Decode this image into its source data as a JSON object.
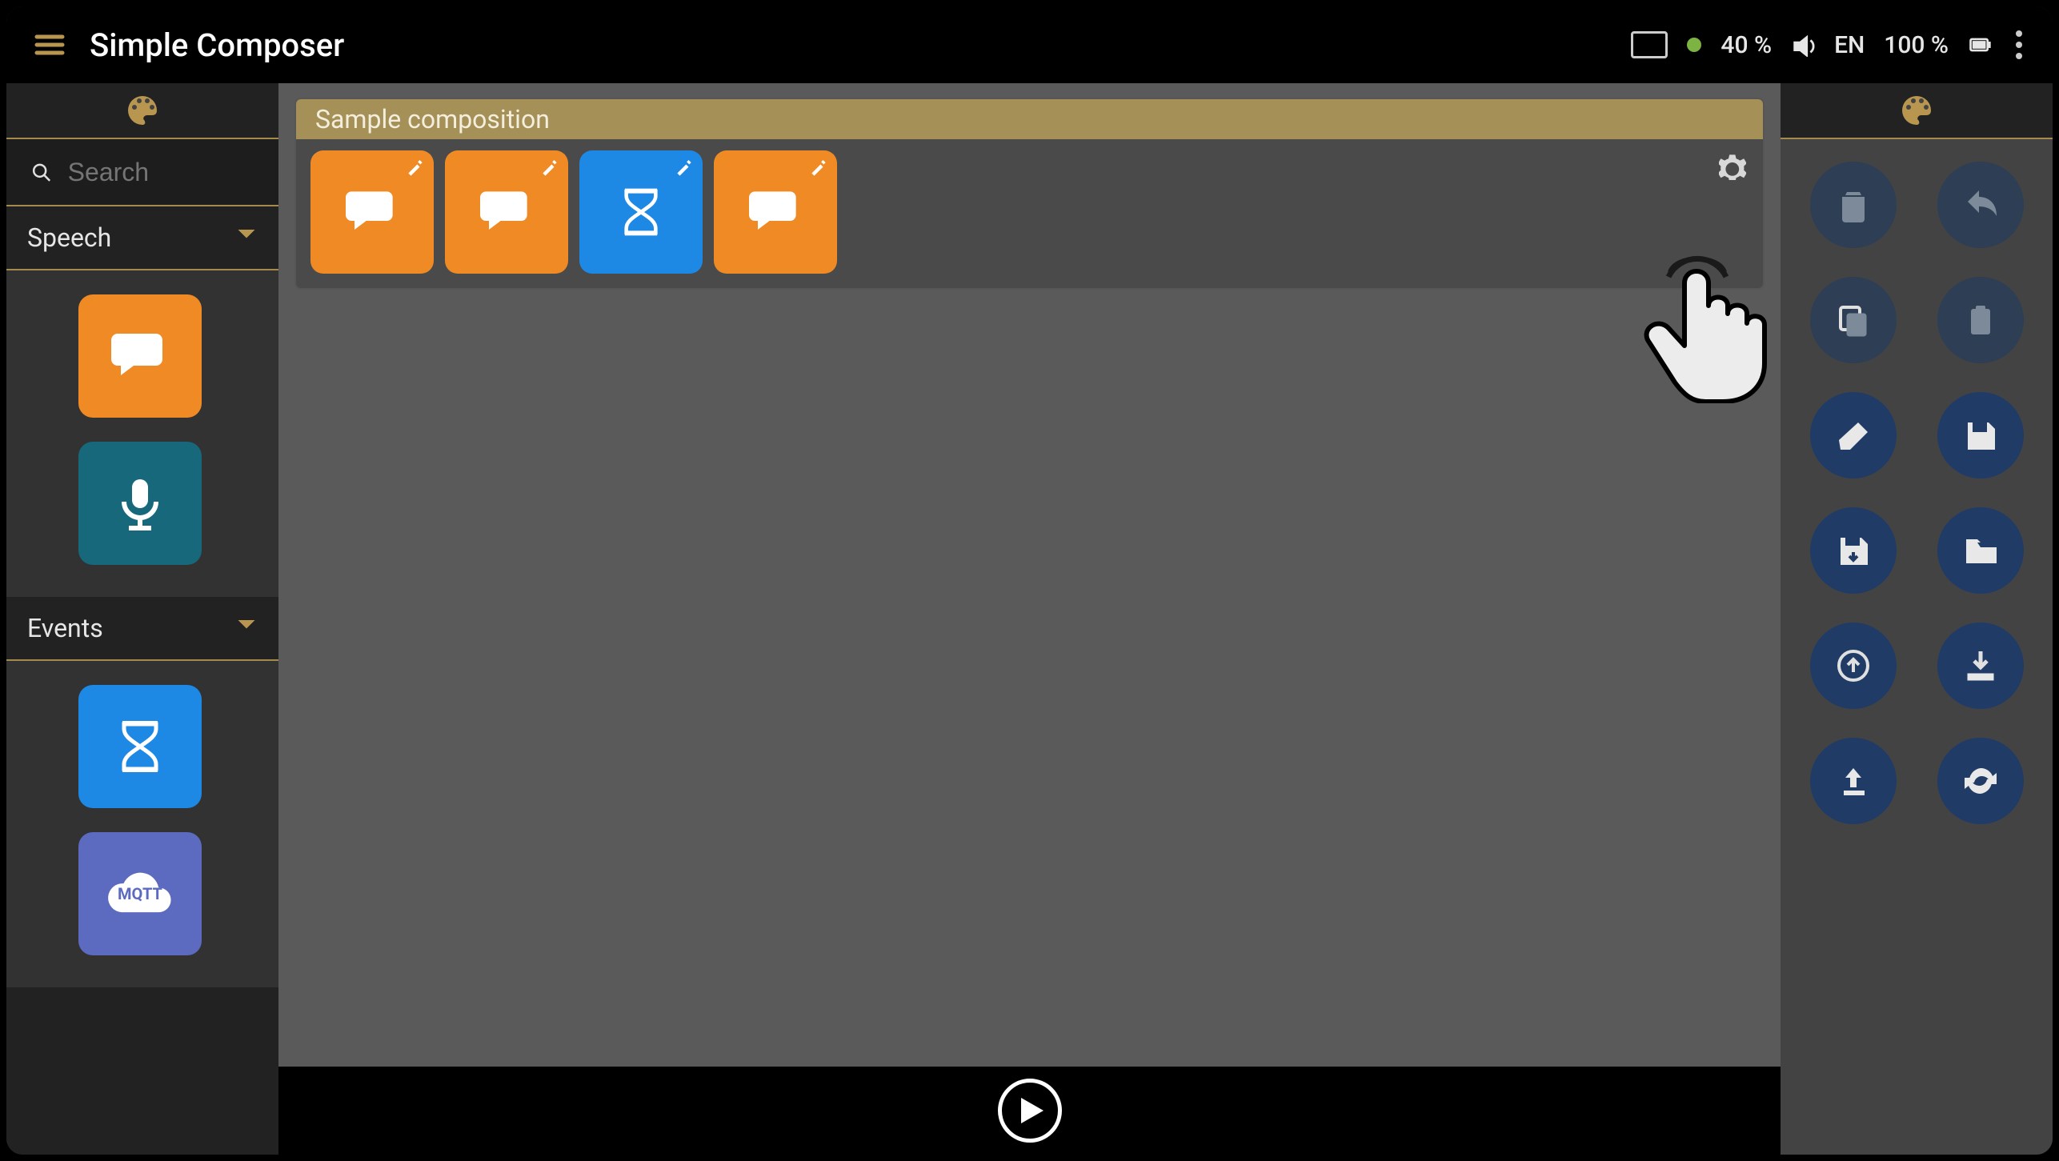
{
  "app": {
    "title": "Simple Composer"
  },
  "status": {
    "brightness": "40 %",
    "lang": "EN",
    "battery": "100 %"
  },
  "search": {
    "placeholder": "Search"
  },
  "sidebar": {
    "categories": [
      {
        "label": "Speech",
        "blocks": [
          {
            "name": "say-block",
            "icon": "speech-bubble-icon",
            "color": "orange"
          },
          {
            "name": "listen-block",
            "icon": "microphone-icon",
            "color": "teal"
          }
        ]
      },
      {
        "label": "Events",
        "blocks": [
          {
            "name": "wait-block",
            "icon": "hourglass-icon",
            "color": "blue"
          },
          {
            "name": "mqtt-block",
            "icon": "mqtt-cloud-icon",
            "color": "purple",
            "text": "MQTT"
          }
        ]
      }
    ]
  },
  "composition": {
    "title": "Sample composition",
    "blocks": [
      {
        "name": "say-block",
        "icon": "speech-bubble-icon",
        "color": "orange"
      },
      {
        "name": "say-block",
        "icon": "speech-bubble-icon",
        "color": "orange"
      },
      {
        "name": "wait-block",
        "icon": "hourglass-icon",
        "color": "blue"
      },
      {
        "name": "say-block",
        "icon": "speech-bubble-icon",
        "color": "orange"
      }
    ]
  },
  "tools": [
    {
      "name": "delete-button",
      "icon": "trash-icon",
      "style": "dim"
    },
    {
      "name": "undo-button",
      "icon": "undo-icon",
      "style": "dim"
    },
    {
      "name": "copy-button",
      "icon": "copy-icon",
      "style": "dim"
    },
    {
      "name": "paste-button",
      "icon": "clipboard-icon",
      "style": "dim"
    },
    {
      "name": "clear-button",
      "icon": "eraser-icon",
      "style": "norm"
    },
    {
      "name": "save-button",
      "icon": "save-icon",
      "style": "norm"
    },
    {
      "name": "save-local-button",
      "icon": "save-drive-icon",
      "style": "norm"
    },
    {
      "name": "open-button",
      "icon": "folder-open-icon",
      "style": "norm"
    },
    {
      "name": "upload-button",
      "icon": "upload-icon",
      "style": "norm"
    },
    {
      "name": "install-button",
      "icon": "download-install-icon",
      "style": "norm"
    },
    {
      "name": "export-button",
      "icon": "export-icon",
      "style": "norm"
    },
    {
      "name": "sync-button",
      "icon": "sync-icon",
      "style": "norm"
    }
  ]
}
